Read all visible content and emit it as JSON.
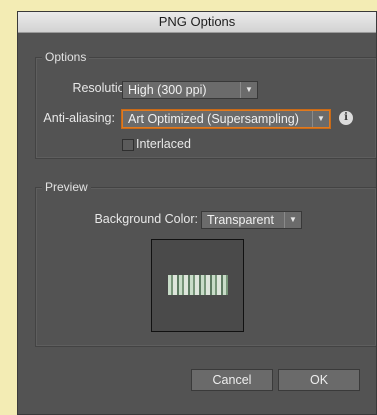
{
  "window": {
    "title": "PNG Options"
  },
  "options": {
    "legend": "Options",
    "resolution": {
      "label": "Resolution:",
      "value": "High (300 ppi)"
    },
    "anti_aliasing": {
      "label": "Anti-aliasing:",
      "value": "Art Optimized (Supersampling)",
      "info_icon": "info-icon"
    },
    "interlaced": {
      "label": "Interlaced",
      "checked": false
    }
  },
  "preview": {
    "legend": "Preview",
    "background_color": {
      "label": "Background Color:",
      "value": "Transparent"
    }
  },
  "buttons": {
    "cancel": "Cancel",
    "ok": "OK"
  },
  "colors": {
    "panel": "#535353",
    "focus": "#e07a1f",
    "background": "#f3ecb4"
  }
}
